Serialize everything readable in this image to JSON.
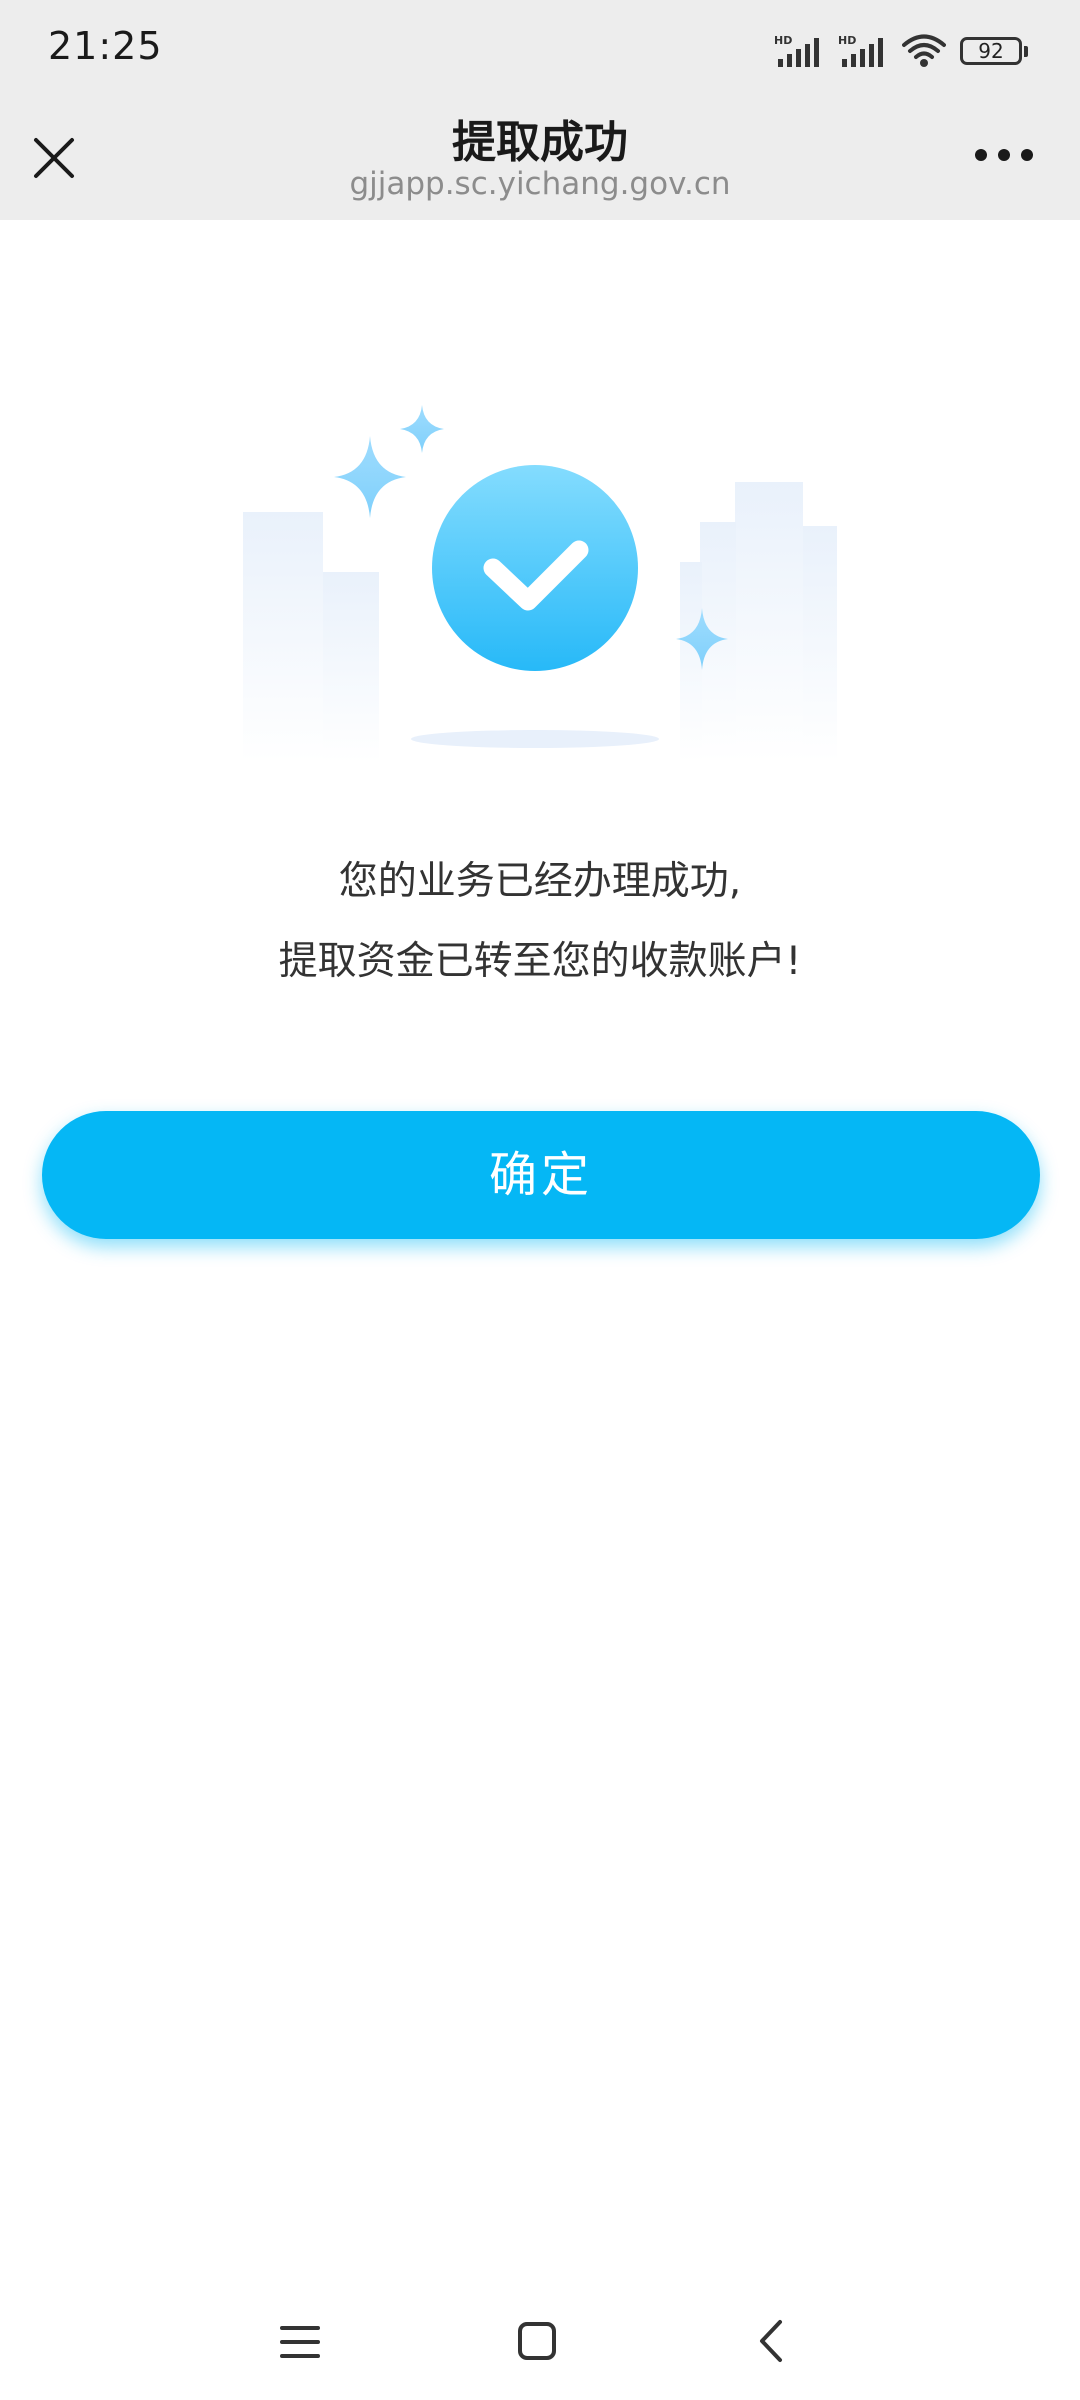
{
  "status_bar": {
    "time": "21:25",
    "battery": "92",
    "icons": [
      "hd-signal-icon",
      "hd-signal-icon",
      "wifi-icon",
      "battery-icon"
    ]
  },
  "nav": {
    "title": "提取成功",
    "url": "gjjapp.sc.yichang.gov.cn",
    "close_icon": "close-icon",
    "more_icon": "more-icon"
  },
  "illustration": {
    "icon": "success-check-icon",
    "accent": "#4cc8fb"
  },
  "message": {
    "line1": "您的业务已经办理成功,",
    "line2": "提取资金已转至您的收款账户!"
  },
  "confirm_button": {
    "label": "确定",
    "color": "#05b7f5"
  },
  "system_nav": {
    "icons": [
      "menu-icon",
      "home-icon",
      "back-icon"
    ]
  }
}
